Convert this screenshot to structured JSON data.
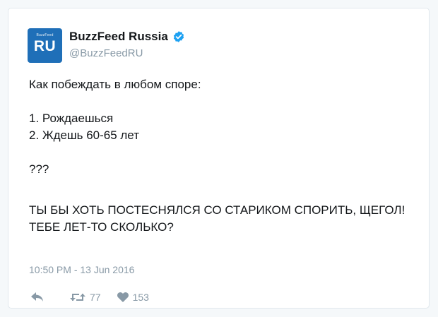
{
  "author": {
    "avatar_small_text": "BuzzFeed",
    "avatar_text": "RU",
    "display_name": "BuzzFeed Russia",
    "handle": "@BuzzFeedRU",
    "verified_icon": "verified-badge-icon"
  },
  "tweet": {
    "lines": [
      "Как побеждать в любом споре:",
      "1. Рождаешься",
      "2. Ждешь 60-65 лет",
      "???",
      "ТЫ БЫ ХОТЬ ПОСТЕСНЯЛСЯ СО СТАРИКОМ СПОРИТЬ, ЩЕГОЛ! ТЕБЕ ЛЕТ-ТО СКОЛЬКО?"
    ],
    "timestamp": "10:50 PM - 13 Jun 2016"
  },
  "actions": {
    "reply_icon": "reply-icon",
    "retweet_icon": "retweet-icon",
    "retweet_count": "77",
    "like_icon": "heart-icon",
    "like_count": "153"
  },
  "colors": {
    "brand_blue": "#1f6fb8",
    "verified_blue": "#1da1f2",
    "muted_gray": "#8899a6",
    "text": "#14171a"
  }
}
